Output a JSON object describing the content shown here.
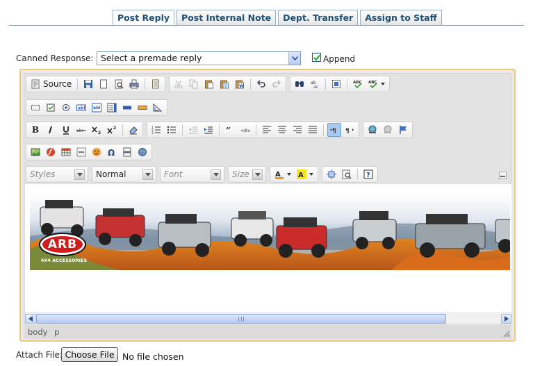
{
  "tabs": [
    {
      "label": "Post Reply",
      "active": true
    },
    {
      "label": "Post Internal Note",
      "active": false
    },
    {
      "label": "Dept. Transfer",
      "active": false
    },
    {
      "label": "Assign to Staff",
      "active": false
    }
  ],
  "canned": {
    "label": "Canned Response:",
    "selected": "Select a premade reply",
    "append_label": "Append",
    "append_checked": true
  },
  "editor": {
    "source_label": "Source",
    "combos": {
      "styles": "Styles",
      "format": "Normal",
      "font": "Font",
      "size": "Size"
    },
    "toolbar_icons": {
      "row1": [
        "source-icon",
        "save-icon",
        "new-page-icon",
        "preview-icon",
        "print-icon",
        "templates-icon",
        "cut-icon",
        "copy-icon",
        "paste-icon",
        "paste-text-icon",
        "paste-word-icon",
        "undo-icon",
        "redo-icon",
        "find-icon",
        "replace-icon",
        "select-all-icon",
        "spellcheck-icon",
        "spellcheck-as-you-type-icon"
      ],
      "row2": [
        "form-icon",
        "checkbox-icon",
        "radio-icon",
        "textfield-icon",
        "textarea-icon",
        "select-field-icon",
        "button-field-icon",
        "image-button-icon",
        "hidden-field-icon"
      ],
      "row3": [
        "bold-icon",
        "italic-icon",
        "underline-icon",
        "strikethrough-icon",
        "subscript-icon",
        "superscript-icon",
        "remove-format-icon",
        "numbered-list-icon",
        "bulleted-list-icon",
        "outdent-icon",
        "indent-icon",
        "blockquote-icon",
        "div-container-icon",
        "align-left-icon",
        "align-center-icon",
        "align-right-icon",
        "justify-icon",
        "ltr-icon",
        "rtl-icon",
        "link-icon",
        "unlink-icon",
        "anchor-icon"
      ],
      "row4": [
        "image-icon",
        "flash-icon",
        "table-icon",
        "horizontal-rule-icon",
        "smiley-icon",
        "special-char-icon",
        "page-break-icon",
        "iframe-icon"
      ],
      "row5": [
        "text-color-icon",
        "bg-color-icon",
        "maximize-icon",
        "show-blocks-icon",
        "about-icon"
      ]
    },
    "banner_logo": "ARB",
    "banner_logo_sub": "4X4 ACCESSORIES",
    "path": "body  p"
  },
  "attach": {
    "label": "Attach File:",
    "button": "Choose File",
    "status": "No file chosen"
  },
  "colors": {
    "tab_text": "#1d4f77",
    "editor_border": "#f1c97e",
    "toolbar_active": "#a9cbf0",
    "logo_red": "#d11c1c"
  }
}
